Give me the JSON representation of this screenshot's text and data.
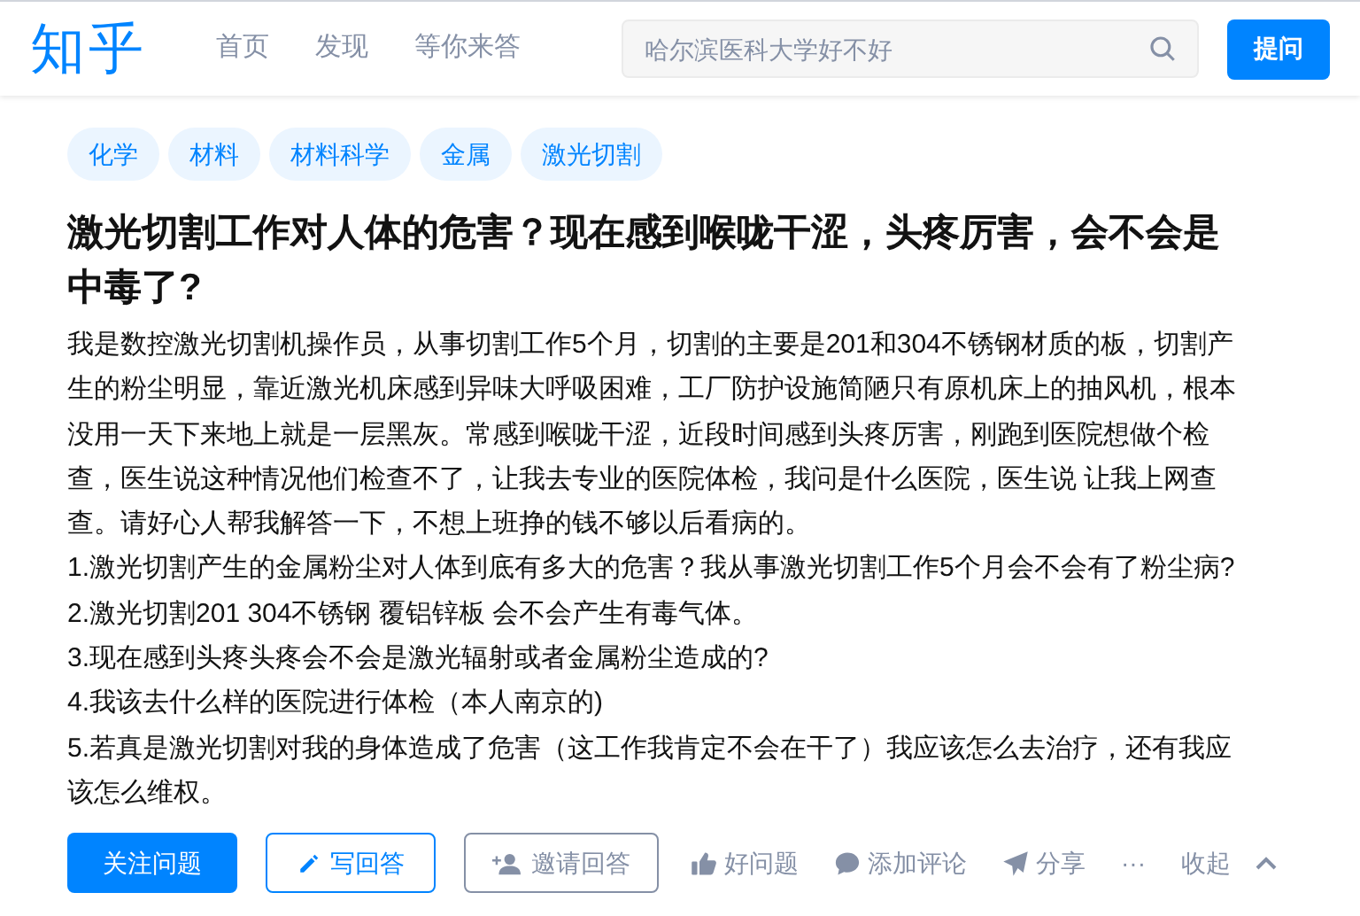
{
  "header": {
    "logo": "知乎",
    "nav": [
      {
        "label": "首页",
        "selected": false
      },
      {
        "label": "发现",
        "selected": false
      },
      {
        "label": "等你来答",
        "selected": false
      }
    ],
    "search": {
      "placeholder": "哈尔滨医科大学好不好"
    },
    "ask_button": "提问"
  },
  "topics": [
    "化学",
    "材料",
    "材料科学",
    "金属",
    "激光切割"
  ],
  "question": {
    "title": "激光切割工作对人体的危害？现在感到喉咙干涩，头疼厉害，会不会是中毒了?",
    "paragraphs": [
      "我是数控激光切割机操作员，从事切割工作5个月，切割的主要是201和304不锈钢材质的板，切割产生的粉尘明显，靠近激光机床感到异味大呼吸困难，工厂防护设施简陋只有原机床上的抽风机，根本没用一天下来地上就是一层黑灰。常感到喉咙干涩，近段时间感到头疼厉害，刚跑到医院想做个检查，医生说这种情况他们检查不了，让我去专业的医院体检，我问是什么医院，医生说 让我上网查查。请好心人帮我解答一下，不想上班挣的钱不够以后看病的。",
      "1.激光切割产生的金属粉尘对人体到底有多大的危害？我从事激光切割工作5个月会不会有了粉尘病?",
      "2.激光切割201 304不锈钢 覆铝锌板 会不会产生有毒气体。",
      "3.现在感到头疼头疼会不会是激光辐射或者金属粉尘造成的?",
      "4.我该去什么样的医院进行体检（本人南京的)",
      "5.若真是激光切割对我的身体造成了危害（这工作我肯定不会在干了）我应该怎么去治疗，还有我应该怎么维权。"
    ]
  },
  "actions": [
    {
      "kind": "primary",
      "label": "关注问题"
    },
    {
      "kind": "write",
      "label": "写回答"
    },
    {
      "kind": "invite",
      "label": "邀请回答"
    },
    {
      "kind": "like",
      "label": "好问题"
    },
    {
      "kind": "comment",
      "label": "添加评论"
    },
    {
      "kind": "share",
      "label": "分享"
    },
    {
      "kind": "more",
      "label": "···"
    },
    {
      "kind": "collapse",
      "label": "收起"
    }
  ]
}
